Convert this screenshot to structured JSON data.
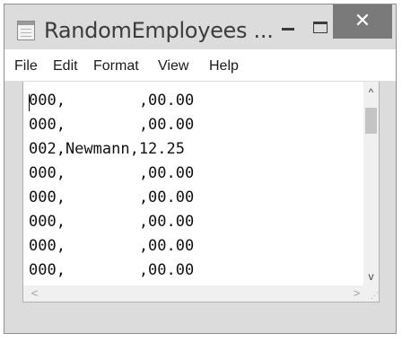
{
  "window": {
    "title": "RandomEmployees ...",
    "icons": {
      "app": "notepad-icon",
      "minimize": "minimize-icon",
      "maximize": "maximize-icon",
      "close": "close-icon"
    },
    "close_glyph": "✕"
  },
  "menu": [
    {
      "label": "File"
    },
    {
      "label": "Edit"
    },
    {
      "label": "Format"
    },
    {
      "label": "View"
    },
    {
      "label": "Help"
    }
  ],
  "document": {
    "lines": [
      "000,        ,00.00",
      "000,        ,00.00",
      "002,Newmann,12.25",
      "000,        ,00.00",
      "000,        ,00.00",
      "000,        ,00.00",
      "000,        ,00.00",
      "000,        ,00.00"
    ]
  },
  "scrollbars": {
    "up_glyph": "^",
    "down_glyph": "v",
    "left_glyph": "<",
    "right_glyph": ">",
    "grip_glyph": "⋰"
  },
  "colors": {
    "close_button": "#7a7a7a",
    "frame": "#dcdcdc"
  }
}
